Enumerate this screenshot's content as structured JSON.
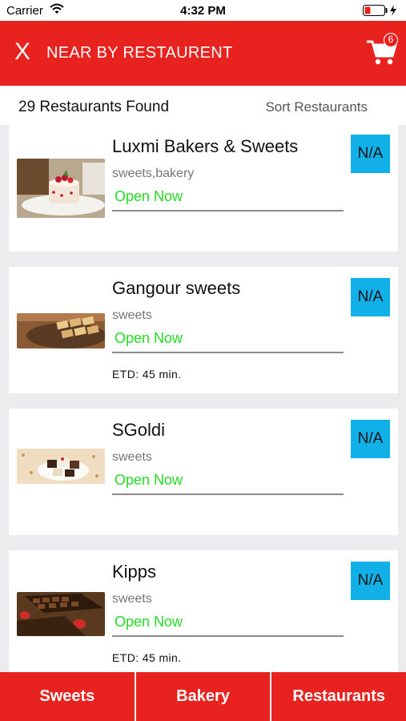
{
  "status_bar": {
    "carrier": "Carrier",
    "time": "4:32 PM",
    "icons": [
      "wifi-icon",
      "battery-low-icon",
      "charging-bolt-icon"
    ]
  },
  "header": {
    "close_label": "X",
    "title": "NEAR BY RESTAURENT",
    "cart_count": "6",
    "background_color": "#e8221f"
  },
  "summary": {
    "count_text": "29 Restaurants Found",
    "sort_label": "Sort Restaurants"
  },
  "restaurants": [
    {
      "name": "Luxmi Bakers & Sweets",
      "category": "sweets,bakery",
      "status": "Open Now",
      "etd": "",
      "rating": "N/A"
    },
    {
      "name": "Gangour sweets",
      "category": "sweets",
      "status": "Open Now",
      "etd": "ETD: 45 min.",
      "rating": "N/A"
    },
    {
      "name": "SGoldi",
      "category": "sweets",
      "status": "Open Now",
      "etd": "",
      "rating": "N/A"
    },
    {
      "name": "Kipps",
      "category": "sweets",
      "status": "Open Now",
      "etd": "ETD: 45 min.",
      "rating": "N/A"
    }
  ],
  "bottom_tabs": [
    {
      "label": "Sweets"
    },
    {
      "label": "Bakery"
    },
    {
      "label": "Restaurants"
    }
  ],
  "colors": {
    "accent": "#e8221f",
    "open_status": "#22dd22",
    "rating_badge": "#12b0e8"
  }
}
